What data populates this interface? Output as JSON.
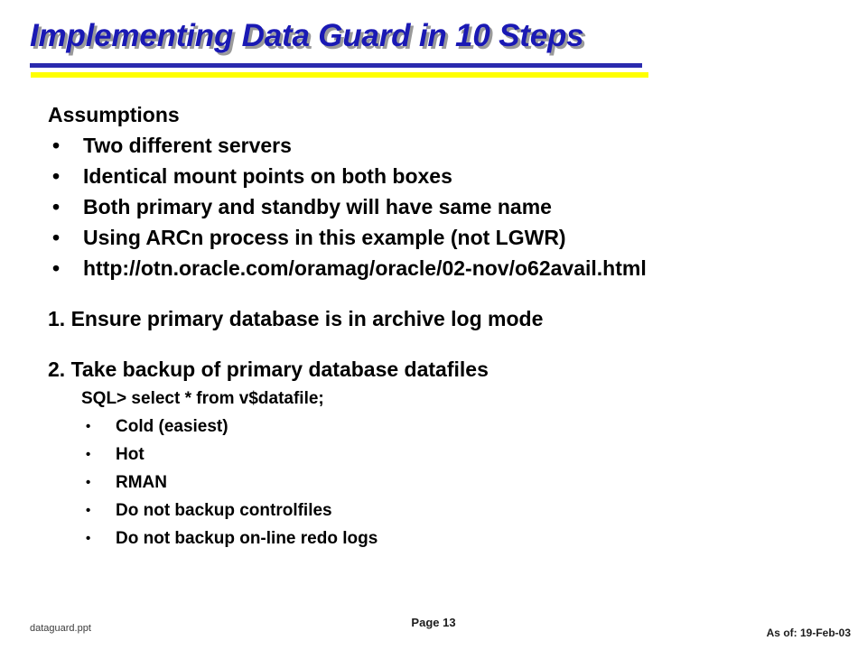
{
  "slide": {
    "title": "Implementing Data Guard in 10 Steps",
    "title_color": "#1A19B4",
    "title_shadow_color": "#9A9A9A",
    "rule_blue_color": "#2A2AAE",
    "rule_yellow_color": "#FFFF00",
    "body": {
      "assumptions_heading": "Assumptions",
      "assumption_bullets": [
        "Two different servers",
        "Identical mount points on both boxes",
        "Both primary and standby will have same name",
        "Using ARCn process in this example (not LGWR)",
        "http://otn.oracle.com/oramag/oracle/02-nov/o62avail.html"
      ],
      "bullet_glyph": "•",
      "step_1": "1. Ensure primary database is in archive log mode",
      "step_2": "2. Take backup of primary database datafiles",
      "sql_line": "SQL> select * from v$datafile;",
      "backup_options": [
        "Cold (easiest)",
        "Hot",
        "RMAN",
        "Do not backup controlfiles",
        "Do not backup on-line redo logs"
      ]
    }
  },
  "footer": {
    "file_name": "dataguard.ppt",
    "page_label": "Page 13",
    "as_of": "As of: 19-Feb-03"
  }
}
